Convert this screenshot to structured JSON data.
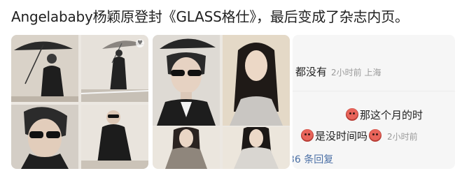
{
  "headline": "Angelababy杨颖原登封《GLASS格仕》，最后变成了杂志内页。",
  "comments": {
    "c1": {
      "text": "都没有",
      "meta": "2小时前 上海"
    },
    "c2": {
      "text": "那这个月的时"
    },
    "c3": {
      "text": "是没时间吗",
      "meta": "2小时前"
    },
    "replies": "36 条回复"
  },
  "photos": [
    {
      "icon": "person-umbrella-photo"
    },
    {
      "icon": "person-umbrella-street-photo"
    },
    {
      "icon": "person-sunglasses-portrait-photo"
    },
    {
      "icon": "person-coat-sunglasses-photo"
    },
    {
      "icon": "person-sunglasses-closeup-photo"
    },
    {
      "icon": "woman-long-hair-photo"
    },
    {
      "icon": "woman-blazer-photo"
    },
    {
      "icon": "woman-white-blazer-photo"
    }
  ]
}
